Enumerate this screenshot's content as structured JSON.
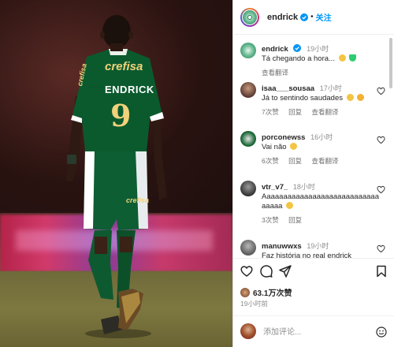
{
  "photo": {
    "jersey_sponsor": "crefisa",
    "jersey_name": "ENDRICK",
    "jersey_number": "9",
    "sleeve_sponsor": "crefisa",
    "shorts_sponsor": "crefisa"
  },
  "header": {
    "username": "endrick",
    "separator": "•",
    "follow_label": "关注"
  },
  "caption": {
    "username": "endrick",
    "time": "19小时",
    "text": "Tá chegando a hora...",
    "translate_label": "查看翻译"
  },
  "comments": [
    {
      "username": "isaa___sousaa",
      "time": "17小时",
      "text": "Já to sentindo saudades",
      "likes": "7次赞",
      "reply": "回复",
      "translate": "查看翻译"
    },
    {
      "username": "porconewss",
      "time": "16小时",
      "text": "Vai não",
      "likes": "6次赞",
      "reply": "回复",
      "translate": "查看翻译"
    },
    {
      "username": "vtr_v7_",
      "time": "18小时",
      "text": "Aaaaaaaaaaaaaaaaaaaaaaaaaaaaaaaaa",
      "likes": "3次赞",
      "reply": "回复"
    },
    {
      "username": "manuwwxs",
      "time": "19小时",
      "text": "Faz história no real endrick"
    }
  ],
  "post": {
    "likes_count": "63.1万次赞",
    "posted_ago": "19小时前"
  },
  "add_comment": {
    "placeholder": "添加评论..."
  },
  "colors": {
    "accent": "#0095f6",
    "jersey_green": "#0b5a2e",
    "jersey_gold": "#f1d27a",
    "text_muted": "#8e8e8e"
  }
}
